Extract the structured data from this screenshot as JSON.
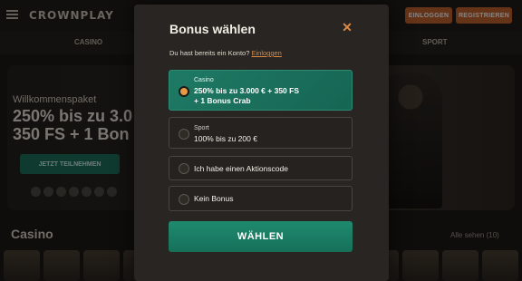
{
  "header": {
    "brand": "CROWNPLAY",
    "login_label": "EINLOGGEN",
    "register_label": "REGISTRIEREN",
    "nav": [
      "CASINO",
      "SPORT"
    ]
  },
  "hero": {
    "tagline": "Willkommenspaket",
    "title_line1": "250% bis zu 3.0",
    "title_line2": "350 FS + 1 Bon",
    "cta": "JETZT TEILNEHMEN"
  },
  "section": {
    "title": "Casino",
    "view_all": "Alle sehen (10)"
  },
  "modal": {
    "title": "Bonus wählen",
    "account_prompt": "Du hast bereits ein Konto?",
    "login_link": "Einloggen",
    "options": [
      {
        "label": "Casino",
        "text_line1": "250% bis zu 3.000 € + 350 FS",
        "text_line2": "+ 1 Bonus Crab",
        "selected": true
      },
      {
        "label": "Sport",
        "text_line1": "100% bis zu 200 €",
        "selected": false
      },
      {
        "label": "",
        "text_line1": "Ich habe einen Aktionscode",
        "selected": false
      },
      {
        "label": "",
        "text_line1": "Kein Bonus",
        "selected": false
      }
    ],
    "submit_label": "WÄHLEN"
  },
  "colors": {
    "accent_orange": "#d98a45",
    "selected_green": "#1e7a64",
    "button_green": "#1f8a6e",
    "modal_bg": "#282522"
  },
  "icons": {
    "menu": "hamburger-icon",
    "close": "close-icon"
  }
}
